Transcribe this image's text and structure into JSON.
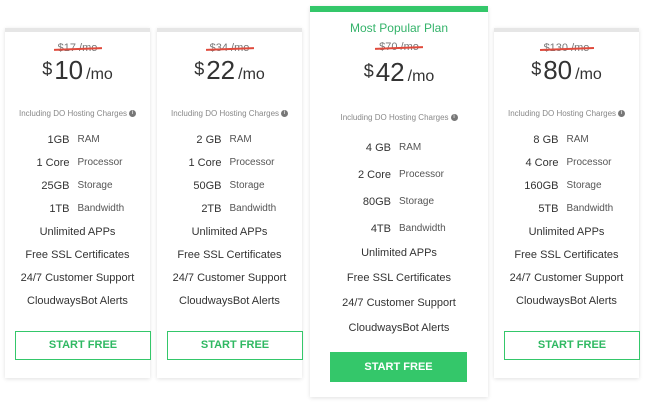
{
  "plans": [
    {
      "popular": "",
      "old_price": "$17 /mo",
      "currency": "$",
      "amount": "10",
      "period": "/mo",
      "note": "Including DO Hosting Charges",
      "specs": [
        {
          "value": "1GB",
          "label": "RAM"
        },
        {
          "value": "1 Core",
          "label": "Processor"
        },
        {
          "value": "25GB",
          "label": "Storage"
        },
        {
          "value": "1TB",
          "label": "Bandwidth"
        }
      ],
      "features": [
        "Unlimited APPs",
        "Free SSL Certificates",
        "24/7 Customer Support",
        "CloudwaysBot Alerts"
      ],
      "button": "START FREE"
    },
    {
      "popular": "",
      "old_price": "$34 /mo",
      "currency": "$",
      "amount": "22",
      "period": "/mo",
      "note": "Including DO Hosting Charges",
      "specs": [
        {
          "value": "2 GB",
          "label": "RAM"
        },
        {
          "value": "1 Core",
          "label": "Processor"
        },
        {
          "value": "50GB",
          "label": "Storage"
        },
        {
          "value": "2TB",
          "label": "Bandwidth"
        }
      ],
      "features": [
        "Unlimited APPs",
        "Free SSL Certificates",
        "24/7 Customer Support",
        "CloudwaysBot Alerts"
      ],
      "button": "START FREE"
    },
    {
      "popular": "Most Popular Plan",
      "old_price": "$70 /mo",
      "currency": "$",
      "amount": "42",
      "period": "/mo",
      "note": "Including DO Hosting Charges",
      "specs": [
        {
          "value": "4 GB",
          "label": "RAM"
        },
        {
          "value": "2 Core",
          "label": "Processor"
        },
        {
          "value": "80GB",
          "label": "Storage"
        },
        {
          "value": "4TB",
          "label": "Bandwidth"
        }
      ],
      "features": [
        "Unlimited APPs",
        "Free SSL Certificates",
        "24/7 Customer Support",
        "CloudwaysBot Alerts"
      ],
      "button": "START FREE"
    },
    {
      "popular": "",
      "old_price": "$130 /mo",
      "currency": "$",
      "amount": "80",
      "period": "/mo",
      "note": "Including DO Hosting Charges",
      "specs": [
        {
          "value": "8 GB",
          "label": "RAM"
        },
        {
          "value": "4 Core",
          "label": "Processor"
        },
        {
          "value": "160GB",
          "label": "Storage"
        },
        {
          "value": "5TB",
          "label": "Bandwidth"
        }
      ],
      "features": [
        "Unlimited APPs",
        "Free SSL Certificates",
        "24/7 Customer Support",
        "CloudwaysBot Alerts"
      ],
      "button": "START FREE"
    }
  ],
  "colors": {
    "accent": "#34c76a",
    "strike": "#e04a3c"
  }
}
